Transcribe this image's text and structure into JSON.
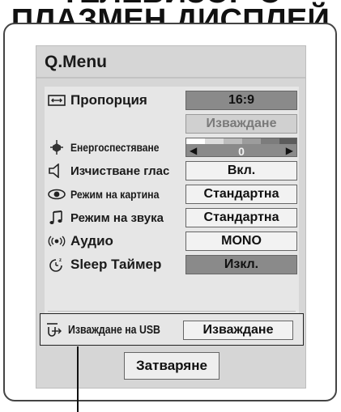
{
  "page": {
    "title_top": "ТЕЛЕВИЗОР С",
    "title_main": "ПЛАЗМЕН ДИСПЛЕЙ"
  },
  "menu": {
    "title": "Q.Menu",
    "rows": [
      {
        "label": "Пропорция",
        "icon": "aspect-ratio-icon",
        "value": "16:9"
      },
      {
        "label": "",
        "icon": "",
        "value": "Изваждане"
      },
      {
        "label": "Енергоспестяване",
        "icon": "energy-saving-icon",
        "value": "0",
        "level": 0
      },
      {
        "label": "Изчистване глас",
        "icon": "clear-voice-icon",
        "value": "Вкл."
      },
      {
        "label": "Режим на картина",
        "icon": "picture-mode-icon",
        "value": "Стандартна"
      },
      {
        "label": "Режим на звука",
        "icon": "sound-mode-icon",
        "value": "Стандартна"
      },
      {
        "label": "Аудио",
        "icon": "audio-icon",
        "value": "MONO"
      },
      {
        "label": "Sleep Таймер",
        "icon": "sleep-timer-icon",
        "value": "Изкл."
      }
    ],
    "usb": {
      "label": "Изваждане на USB",
      "icon": "usb-eject-icon",
      "value": "Изваждане"
    },
    "close_label": "Затваряне"
  },
  "colors": {
    "panel_bg": "#e6e6e6",
    "card_bg": "#d6d6d6",
    "selected_value_bg": "#8a8a8a",
    "slider_segments": [
      "#ffffff",
      "#dcdcdc",
      "#bcbcbc",
      "#9c9c9c",
      "#7c7c7c",
      "#5c5c5c"
    ]
  }
}
